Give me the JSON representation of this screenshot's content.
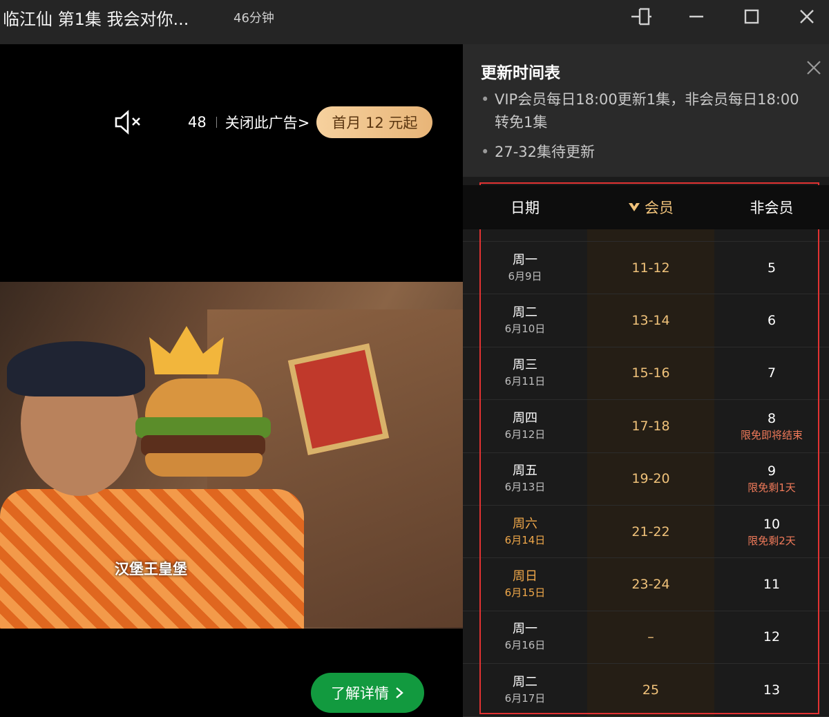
{
  "window": {
    "title": "临江仙 第1集 我会对你...",
    "duration": "46分钟"
  },
  "ad": {
    "countdown": "48",
    "close_label": "关闭此广告>",
    "vip_offer": "首月 12 元起",
    "caption": "汉堡王皇堡",
    "learn_more": "了解详情"
  },
  "schedule": {
    "title": "更新时间表",
    "notes": [
      "VIP会员每日18:00更新1集，非会员每日18:00转免1集",
      "27-32集待更新"
    ],
    "headers": {
      "date": "日期",
      "vip": "会员",
      "free": "非会员"
    },
    "rows": [
      {
        "day": "周一",
        "date": "6月9日",
        "vip": "11-12",
        "free": "5",
        "note": "",
        "weekend": false
      },
      {
        "day": "周二",
        "date": "6月10日",
        "vip": "13-14",
        "free": "6",
        "note": "",
        "weekend": false
      },
      {
        "day": "周三",
        "date": "6月11日",
        "vip": "15-16",
        "free": "7",
        "note": "",
        "weekend": false
      },
      {
        "day": "周四",
        "date": "6月12日",
        "vip": "17-18",
        "free": "8",
        "note": "限免即将结束",
        "weekend": false
      },
      {
        "day": "周五",
        "date": "6月13日",
        "vip": "19-20",
        "free": "9",
        "note": "限免剩1天",
        "weekend": false
      },
      {
        "day": "周六",
        "date": "6月14日",
        "vip": "21-22",
        "free": "10",
        "note": "限免剩2天",
        "weekend": true
      },
      {
        "day": "周日",
        "date": "6月15日",
        "vip": "23-24",
        "free": "11",
        "note": "",
        "weekend": true
      },
      {
        "day": "周一",
        "date": "6月16日",
        "vip": "–",
        "free": "12",
        "note": "",
        "weekend": false
      },
      {
        "day": "周二",
        "date": "6月17日",
        "vip": "25",
        "free": "13",
        "note": "",
        "weekend": false
      }
    ]
  },
  "colors": {
    "accent_gold": "#f0c27a",
    "weekend_orange": "#f0a84a",
    "note_red": "#f07a5a",
    "cta_green": "#129a3f",
    "highlight_border": "#e23232"
  }
}
